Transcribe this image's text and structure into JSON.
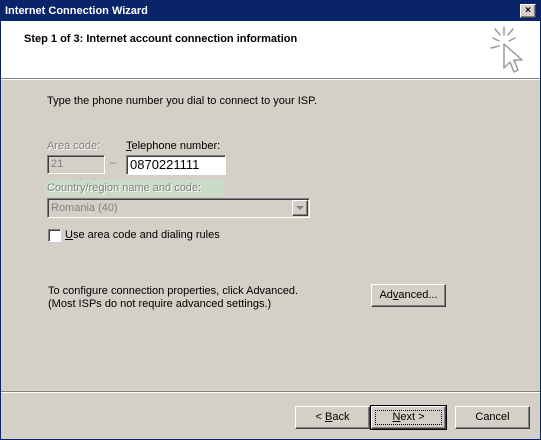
{
  "window": {
    "title": "Internet Connection Wizard",
    "close_label": "×"
  },
  "header": {
    "step_title": "Step 1 of 3: Internet account connection information"
  },
  "body": {
    "instruction": "Type the phone number you dial to connect to your ISP.",
    "area_code": {
      "label": "Area code:",
      "value": "21"
    },
    "dash": "–",
    "telephone": {
      "label_underlined": "T",
      "label_rest": "elephone number:",
      "value": "0870221111"
    },
    "country": {
      "label": "Country/region name and code:",
      "value": "Romania (40)"
    },
    "use_area_code": {
      "label_underlined": "U",
      "label_rest": "se area code and dialing rules",
      "checked": false
    },
    "advanced_note": {
      "line1": "To configure connection properties, click Advanced.",
      "line2": "(Most ISPs do not require advanced settings.)"
    }
  },
  "buttons": {
    "advanced": {
      "before": "Ad",
      "underlined": "v",
      "after": "anced..."
    },
    "back": {
      "before": "< ",
      "underlined": "B",
      "after": "ack"
    },
    "next": {
      "before": "",
      "underlined": "N",
      "after": "ext >"
    },
    "cancel": "Cancel"
  },
  "colors": {
    "titlebar": "#0a246a",
    "face": "#d4d0c8",
    "header_bg": "#ffffff",
    "disabled_text": "#808080",
    "country_label_highlight": "#c9dcc6"
  },
  "icons": {
    "wizard": "wizard-cursor-sparkle-icon",
    "dropdown": "chevron-down-icon"
  }
}
